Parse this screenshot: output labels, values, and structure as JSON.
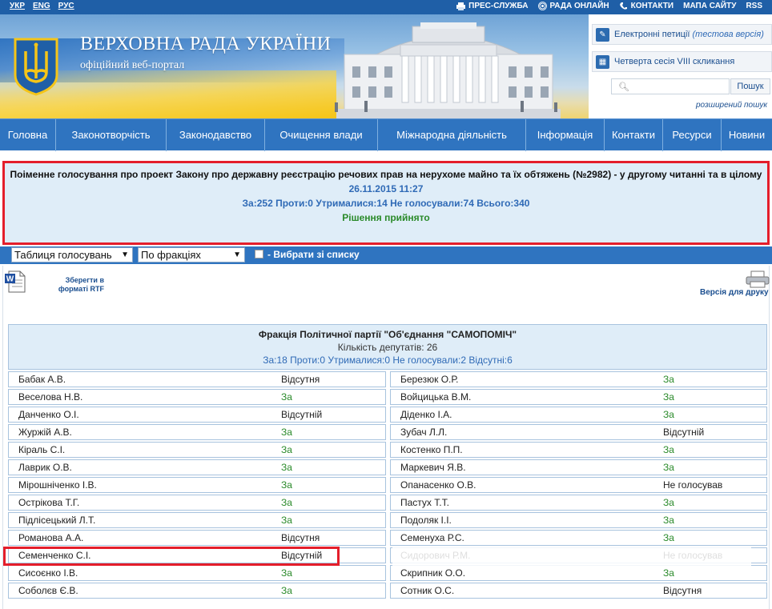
{
  "topbar": {
    "languages": [
      "УКР",
      "ENG",
      "РУС"
    ],
    "links": [
      "ПРЕС-СЛУЖБА",
      "РАДА ОНЛАЙН",
      "КОНТАКТИ",
      "МАПА САЙТУ",
      "RSS"
    ]
  },
  "header": {
    "title": "ВЕРХОВНА РАДА УКРАЇНИ",
    "subtitle": "офіційний веб-портал"
  },
  "right_panel": {
    "petitions_label": "Електронні петиції",
    "petitions_note": "(тестова версія)",
    "session_label": "Четверта сесія VIII скликання",
    "search_placeholder": "",
    "search_button": "Пошук",
    "advanced_search": "розширений пошук"
  },
  "nav": {
    "items": [
      "Головна",
      "Законотворчість",
      "Законодавство",
      "Очищення влади",
      "Міжнародна діяльність",
      "Інформація",
      "Контакти",
      "Ресурси",
      "Новини"
    ]
  },
  "vote": {
    "title": "Поіменне голосування про проект Закону про державну реєстрацію речових прав на нерухоме майно та їх обтяжень (№2982) - у другому читанні та в цілому",
    "datetime": "26.11.2015 11:27",
    "summary": "За:252 Проти:0 Утрималися:14 Не голосували:74 Всього:340",
    "result": "Рішення прийнято"
  },
  "filters": {
    "view_select": "Таблиця голосувань",
    "group_select": "По фракціях",
    "checkbox_label": "- Вибрати зі списку"
  },
  "actions": {
    "save_rtf": "Зберегти в форматі RTF",
    "print_version": "Версія для друку"
  },
  "faction": {
    "name": "Фракція Політичної партії \"Об'єднання \"САМОПОМІЧ\"",
    "count": "Кількість депутатів: 26",
    "summary": "За:18 Проти:0 Утрималися:0 Не голосували:2 Відсутні:6"
  },
  "deputies_left": [
    {
      "name": "Бабак А.В.",
      "vote": "Відсутня"
    },
    {
      "name": "Веселова Н.В.",
      "vote": "За"
    },
    {
      "name": "Данченко О.І.",
      "vote": "Відсутній"
    },
    {
      "name": "Журжій А.В.",
      "vote": "За"
    },
    {
      "name": "Кіраль С.І.",
      "vote": "За"
    },
    {
      "name": "Лаврик О.В.",
      "vote": "За"
    },
    {
      "name": "Мірошніченко І.В.",
      "vote": "За"
    },
    {
      "name": "Острікова Т.Г.",
      "vote": "За"
    },
    {
      "name": "Підлісецький Л.Т.",
      "vote": "За"
    },
    {
      "name": "Романова А.А.",
      "vote": "Відсутня"
    },
    {
      "name": "Семенченко С.І.",
      "vote": "Відсутній"
    },
    {
      "name": "Сисоєнко І.В.",
      "vote": "За"
    },
    {
      "name": "Соболєв Є.В.",
      "vote": "За"
    }
  ],
  "deputies_right": [
    {
      "name": "Березюк О.Р.",
      "vote": "За"
    },
    {
      "name": "Войцицька В.М.",
      "vote": "За"
    },
    {
      "name": "Діденко І.А.",
      "vote": "За"
    },
    {
      "name": "Зубач Л.Л.",
      "vote": "Відсутній"
    },
    {
      "name": "Костенко П.П.",
      "vote": "За"
    },
    {
      "name": "Маркевич Я.В.",
      "vote": "За"
    },
    {
      "name": "Опанасенко О.В.",
      "vote": "Не голосував"
    },
    {
      "name": "Пастух Т.Т.",
      "vote": "За"
    },
    {
      "name": "Подоляк І.І.",
      "vote": "За"
    },
    {
      "name": "Семенуха Р.С.",
      "vote": "За"
    },
    {
      "name": "Сидорович Р.М.",
      "vote": "Не голосував"
    },
    {
      "name": "Скрипник О.О.",
      "vote": "За"
    },
    {
      "name": "Сотник О.С.",
      "vote": "Відсутня"
    }
  ],
  "colors": {
    "nav_blue": "#2f74c0",
    "vote_yes": "#2a8a2a",
    "highlight_red": "#e41e2b",
    "info_bg": "#dfedf8"
  }
}
